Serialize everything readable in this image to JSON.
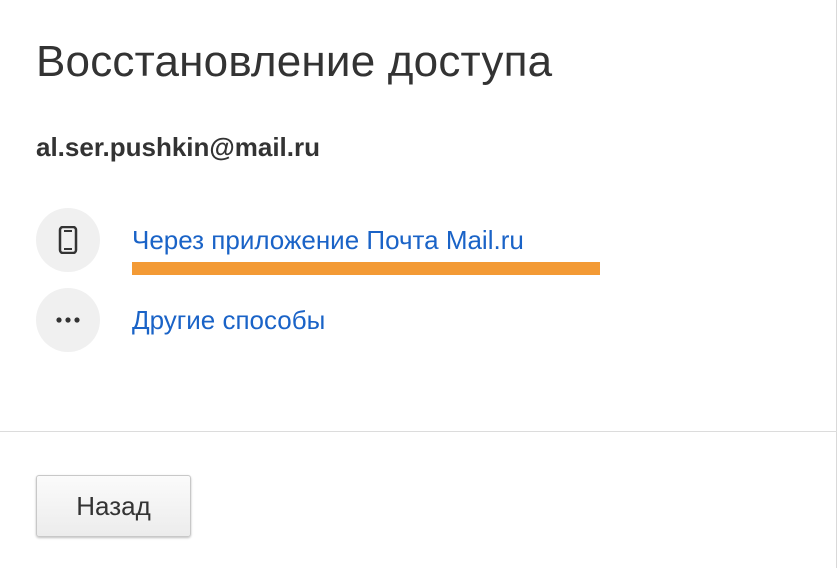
{
  "page": {
    "title": "Восстановление доступа",
    "email": "al.ser.pushkin@mail.ru"
  },
  "methods": [
    {
      "label": "Через приложение Почта Mail.ru",
      "icon": "smartphone-icon"
    },
    {
      "label": "Другие способы",
      "icon": "more-dots-icon"
    }
  ],
  "footer": {
    "back_label": "Назад"
  },
  "colors": {
    "link": "#1a63c7",
    "highlight": "#f39a35",
    "icon_bg": "#f0f0f0",
    "text": "#333333"
  }
}
